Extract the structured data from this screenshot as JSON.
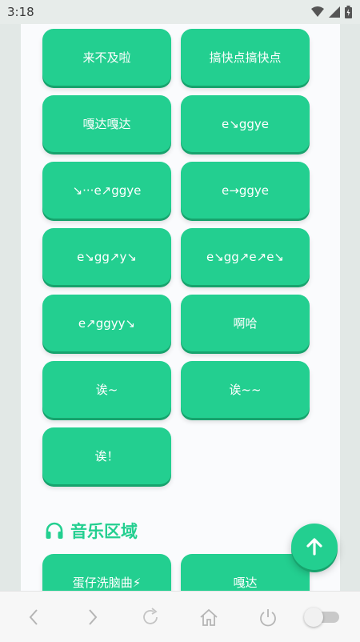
{
  "status": {
    "time": "3:18"
  },
  "buttons": [
    "来不及啦",
    "搞快点搞快点",
    "嘎达嘎达",
    "e↘ggye",
    "↘···e↗ggye",
    "e→ggye",
    "e↘gg↗y↘",
    "e↘gg↗e↗e↘",
    "e↗ggyy↘",
    "啊哈",
    "诶~",
    "诶~~",
    "诶！"
  ],
  "music_section": {
    "title": "音乐区域",
    "icon": "headphones-icon",
    "buttons": [
      "蛋仔洗脑曲⚡",
      "嘎达"
    ]
  },
  "fab": {
    "icon": "arrow-up-icon"
  },
  "colors": {
    "accent": "#23cf90",
    "accent_dark": "#17a36d"
  }
}
